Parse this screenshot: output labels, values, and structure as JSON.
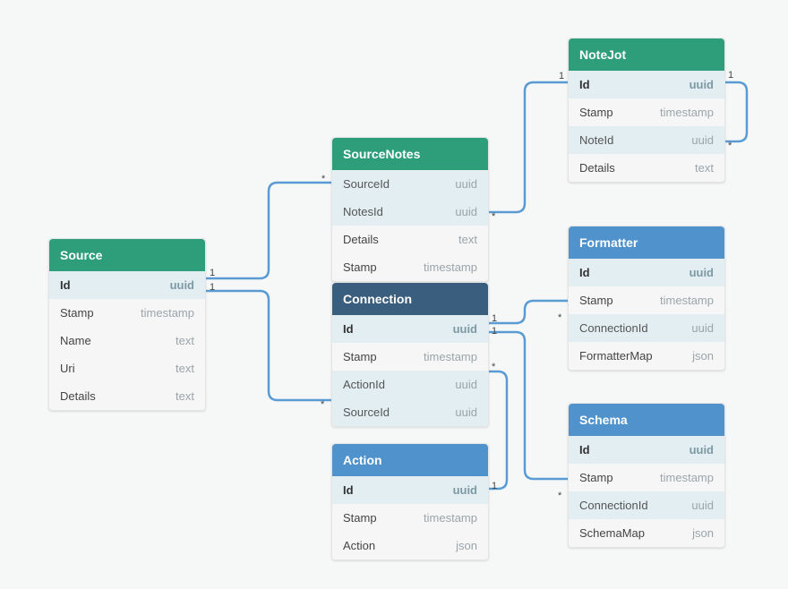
{
  "entities": {
    "source": {
      "title": "Source",
      "fields": [
        {
          "name": "Id",
          "type": "uuid",
          "kind": "pk"
        },
        {
          "name": "Stamp",
          "type": "timestamp",
          "kind": "normal"
        },
        {
          "name": "Name",
          "type": "text",
          "kind": "normal"
        },
        {
          "name": "Uri",
          "type": "text",
          "kind": "normal"
        },
        {
          "name": "Details",
          "type": "text",
          "kind": "normal"
        }
      ]
    },
    "sourcenotes": {
      "title": "SourceNotes",
      "fields": [
        {
          "name": "SourceId",
          "type": "uuid",
          "kind": "fk"
        },
        {
          "name": "NotesId",
          "type": "uuid",
          "kind": "fk"
        },
        {
          "name": "Details",
          "type": "text",
          "kind": "normal"
        },
        {
          "name": "Stamp",
          "type": "timestamp",
          "kind": "normal"
        }
      ]
    },
    "notejot": {
      "title": "NoteJot",
      "fields": [
        {
          "name": "Id",
          "type": "uuid",
          "kind": "pk"
        },
        {
          "name": "Stamp",
          "type": "timestamp",
          "kind": "normal"
        },
        {
          "name": "NoteId",
          "type": "uuid",
          "kind": "fk"
        },
        {
          "name": "Details",
          "type": "text",
          "kind": "normal"
        }
      ]
    },
    "connection": {
      "title": "Connection",
      "fields": [
        {
          "name": "Id",
          "type": "uuid",
          "kind": "pk"
        },
        {
          "name": "Stamp",
          "type": "timestamp",
          "kind": "normal"
        },
        {
          "name": "ActionId",
          "type": "uuid",
          "kind": "fk"
        },
        {
          "name": "SourceId",
          "type": "uuid",
          "kind": "fk"
        }
      ]
    },
    "action": {
      "title": "Action",
      "fields": [
        {
          "name": "Id",
          "type": "uuid",
          "kind": "pk"
        },
        {
          "name": "Stamp",
          "type": "timestamp",
          "kind": "normal"
        },
        {
          "name": "Action",
          "type": "json",
          "kind": "normal"
        }
      ]
    },
    "formatter": {
      "title": "Formatter",
      "fields": [
        {
          "name": "Id",
          "type": "uuid",
          "kind": "pk"
        },
        {
          "name": "Stamp",
          "type": "timestamp",
          "kind": "normal"
        },
        {
          "name": "ConnectionId",
          "type": "uuid",
          "kind": "fk"
        },
        {
          "name": "FormatterMap",
          "type": "json",
          "kind": "normal"
        }
      ]
    },
    "schema": {
      "title": "Schema",
      "fields": [
        {
          "name": "Id",
          "type": "uuid",
          "kind": "pk"
        },
        {
          "name": "Stamp",
          "type": "timestamp",
          "kind": "normal"
        },
        {
          "name": "ConnectionId",
          "type": "uuid",
          "kind": "fk"
        },
        {
          "name": "SchemaMap",
          "type": "json",
          "kind": "normal"
        }
      ]
    }
  },
  "cardinality": {
    "one": "1",
    "many": "*"
  }
}
